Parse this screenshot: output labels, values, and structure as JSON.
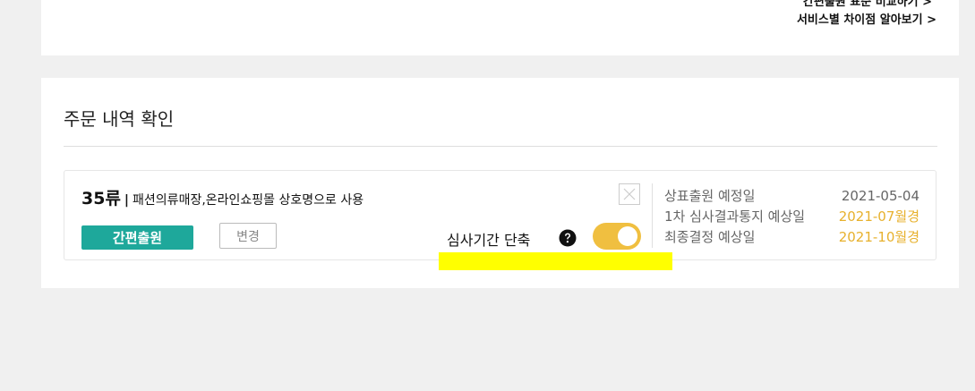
{
  "top_card": {
    "cut_text": "간편출원 표준 비교하기 >",
    "diff_link": "서비스별 차이점 알아보기 >"
  },
  "order": {
    "title": "주문 내역 확인",
    "item": {
      "class_num": "35류",
      "separator": "|",
      "class_desc": "패션의류매장,온라인쇼핑몰 상호명으로 사용",
      "type_badge": "간편출원",
      "change_label": "변경",
      "shorten_label": "심사기간 단축",
      "toggle_on": true,
      "colors": {
        "toggle": "#f0bf40",
        "badge": "#1ea89b",
        "estimate": "#e7b12d",
        "highlight": "#ffff00"
      }
    },
    "dates": [
      {
        "label": "상표출원 예정일",
        "value": "2021-05-04",
        "estimated": false
      },
      {
        "label": "1차 심사결과통지 예상일",
        "value": "2021-07월경",
        "estimated": true
      },
      {
        "label": "최종결정 예상일",
        "value": "2021-10월경",
        "estimated": true
      }
    ]
  }
}
